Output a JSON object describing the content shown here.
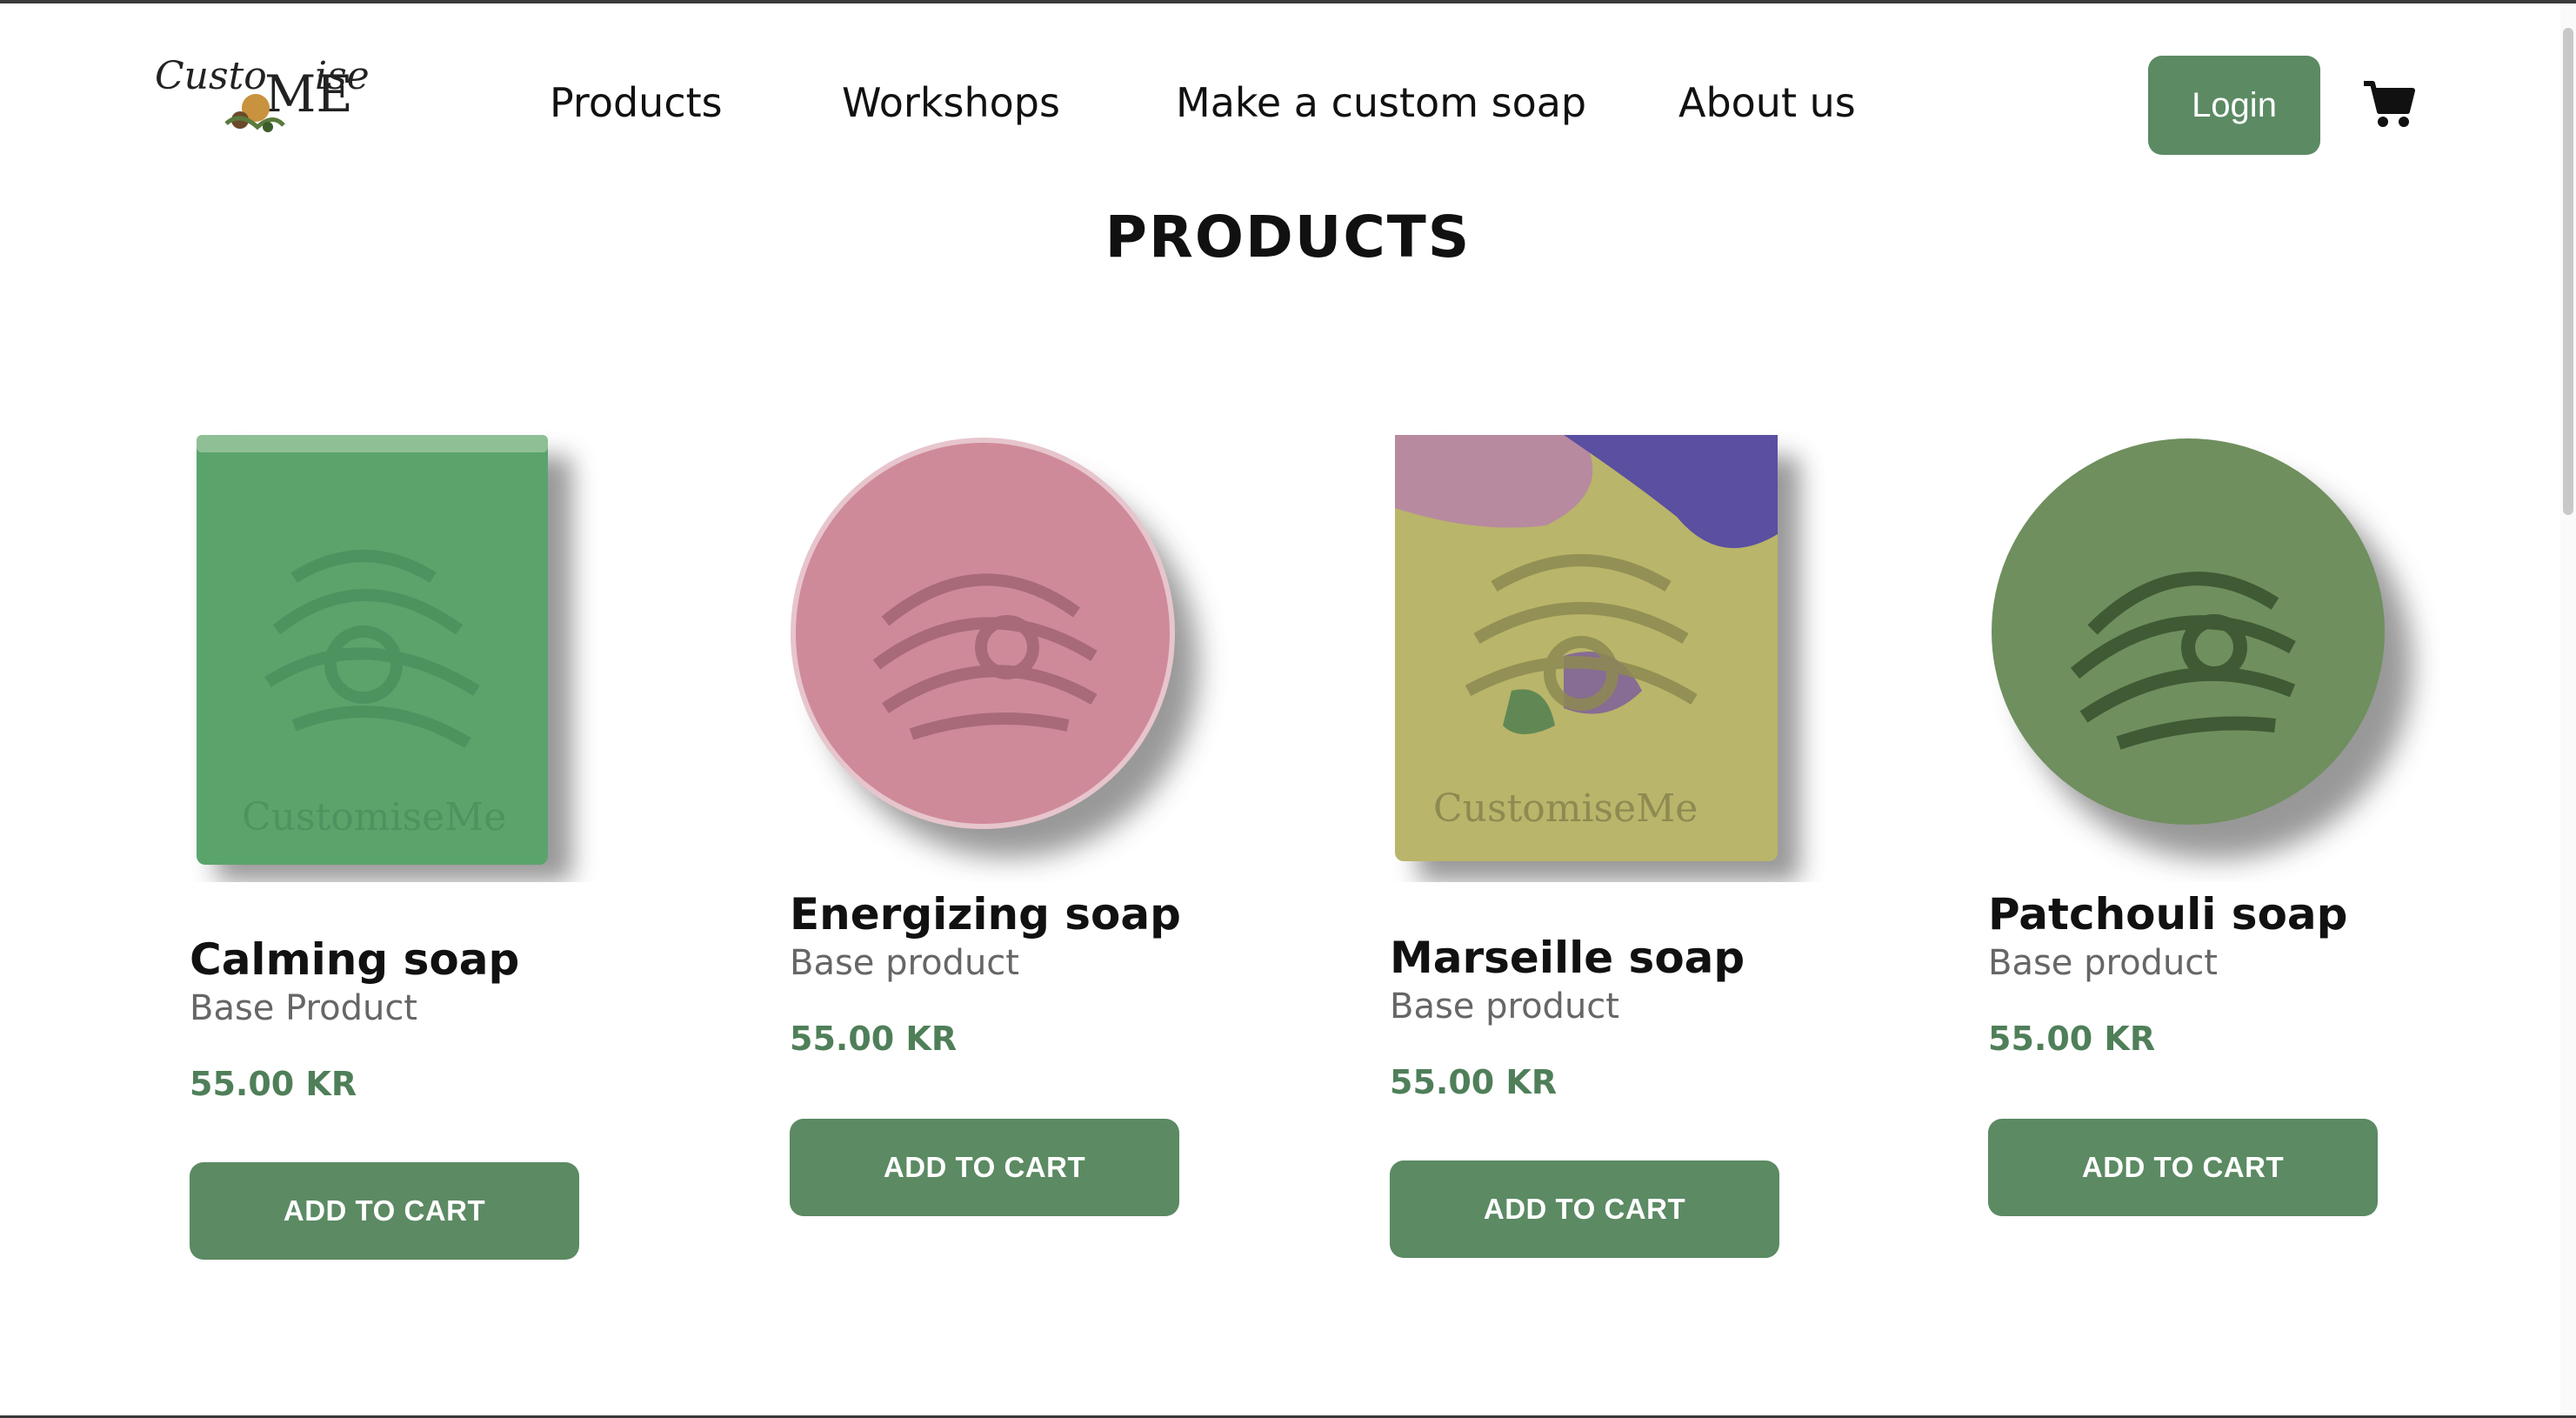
{
  "header": {
    "logo_text_top": "Custo",
    "logo_text_me": "ME",
    "logo_text_ise": "ise",
    "nav": [
      {
        "label": "Products"
      },
      {
        "label": "Workshops"
      },
      {
        "label": "Make a custom soap"
      },
      {
        "label": "About us"
      }
    ],
    "login_label": "Login",
    "cart_icon": "shopping-cart-icon"
  },
  "main": {
    "title": "PRODUCTS",
    "products": [
      {
        "name": "Calming soap",
        "subtitle": "Base Product",
        "price": "55.00 KR",
        "button": "ADD TO CART",
        "image": "green-square-soap",
        "color": "#5aa46c"
      },
      {
        "name": "Energizing soap",
        "subtitle": "Base product",
        "price": "55.00 KR",
        "button": "ADD TO CART",
        "image": "pink-round-soap",
        "color": "#cf8a9a"
      },
      {
        "name": "Marseille soap",
        "subtitle": "Base product",
        "price": "55.00 KR",
        "button": "ADD TO CART",
        "image": "marbled-square-soap",
        "color": "#b9b56a"
      },
      {
        "name": "Patchouli soap",
        "subtitle": "Base product",
        "price": "55.00 KR",
        "button": "ADD TO CART",
        "image": "olive-round-soap",
        "color": "#6f8f5e"
      }
    ]
  },
  "colors": {
    "accent": "#5b8a63",
    "price": "#4f7f59"
  }
}
